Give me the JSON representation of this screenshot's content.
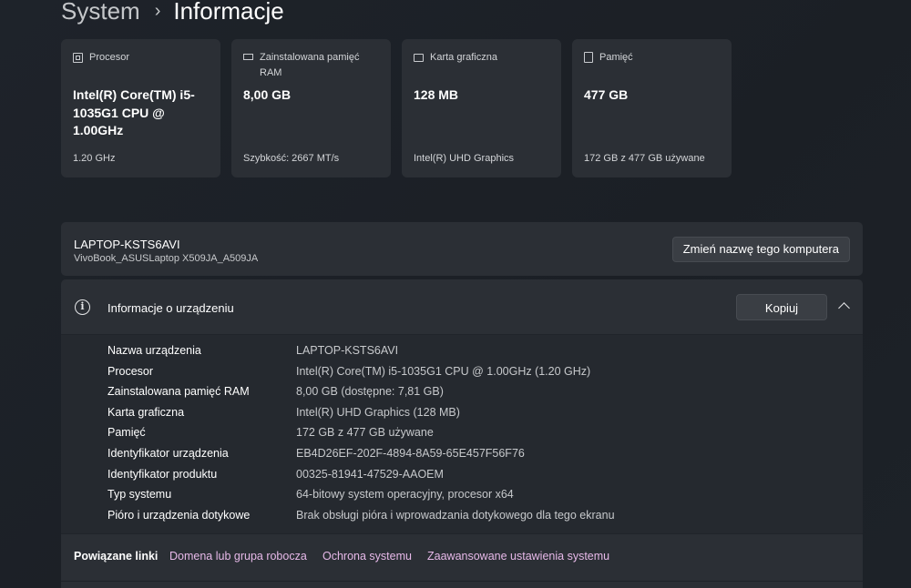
{
  "breadcrumb": {
    "parent": "System",
    "separator": "›",
    "current": "Informacje"
  },
  "cards": [
    {
      "icon": "processor-icon",
      "title": "Procesor",
      "value": "Intel(R) Core(TM) i5-1035G1 CPU @ 1.00GHz",
      "footer": "1.20 GHz"
    },
    {
      "icon": "ram-icon",
      "title": "Zainstalowana pamięć RAM",
      "value": "8,00 GB",
      "footer": "Szybkość: 2667 MT/s"
    },
    {
      "icon": "graphics-card-icon",
      "title": "Karta graficzna",
      "value": "128 MB",
      "footer": "Intel(R) UHD Graphics"
    },
    {
      "icon": "storage-icon",
      "title": "Pamięć",
      "value": "477 GB",
      "footer": "172 GB z 477 GB używane"
    }
  ],
  "device": {
    "name": "LAPTOP-KSTS6AVI",
    "model": "VivoBook_ASUSLaptop X509JA_A509JA",
    "rename_label": "Zmień nazwę tego komputera"
  },
  "specs": {
    "title": "Informacje o urządzeniu",
    "copy_label": "Kopiuj",
    "rows": [
      {
        "label": "Nazwa urządzenia",
        "value": "LAPTOP-KSTS6AVI"
      },
      {
        "label": "Procesor",
        "value": "Intel(R) Core(TM) i5-1035G1 CPU @ 1.00GHz (1.20 GHz)"
      },
      {
        "label": "Zainstalowana pamięć RAM",
        "value": "8,00 GB (dostępne: 7,81 GB)"
      },
      {
        "label": "Karta graficzna",
        "value": "Intel(R) UHD Graphics (128 MB)"
      },
      {
        "label": "Pamięć",
        "value": "172 GB z 477 GB używane"
      },
      {
        "label": "Identyfikator urządzenia",
        "value": "EB4D26EF-202F-4894-8A59-65E457F56F76"
      },
      {
        "label": "Identyfikator produktu",
        "value": "00325-81941-47529-AAOEM"
      },
      {
        "label": "Typ systemu",
        "value": "64-bitowy system operacyjny, procesor x64"
      },
      {
        "label": "Pióro i urządzenia dotykowe",
        "value": "Brak obsługi pióra i wprowadzania dotykowego dla tego ekranu"
      }
    ]
  },
  "related": {
    "title": "Powiązane linki",
    "links": [
      "Domena lub grupa robocza",
      "Ochrona systemu",
      "Zaawansowane ustawienia systemu"
    ]
  },
  "colors": {
    "accent_link": "#e7b9e9",
    "card_bg": "#2b2f35"
  }
}
